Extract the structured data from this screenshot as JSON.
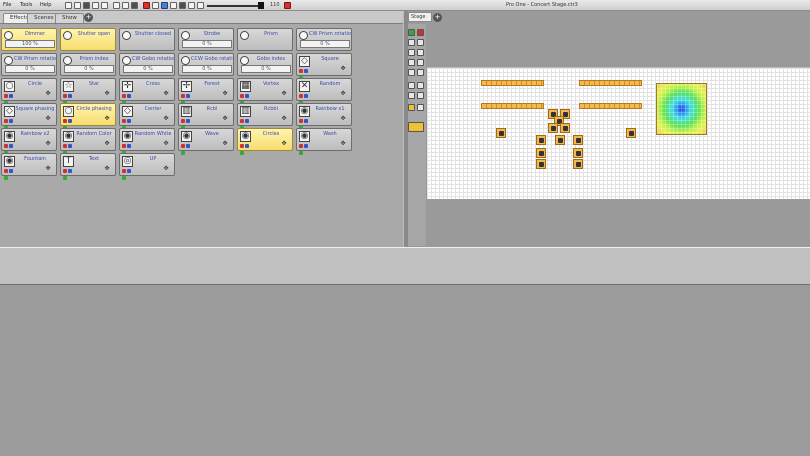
{
  "menubar": {
    "file": "File",
    "tools": "Tools",
    "help": "Help"
  },
  "volume": {
    "value_text": "110",
    "level": 0.95
  },
  "window_title": "Pro One - Concert Stage.ctr3",
  "left_tabs": [
    {
      "label": "Effects",
      "active": true
    },
    {
      "label": "Scenes",
      "active": false
    },
    {
      "label": "Show",
      "active": false
    }
  ],
  "right_tab": {
    "label": "Stage"
  },
  "buttons": [
    {
      "label": "Dimmer",
      "value": "100 %",
      "kind": "slider",
      "hl": true
    },
    {
      "label": "Shutter open",
      "kind": "plain",
      "hl": true
    },
    {
      "label": "Shutter closed",
      "kind": "plain",
      "hl": false
    },
    {
      "label": "Strobe",
      "value": "0 %",
      "kind": "slider",
      "hl": false
    },
    {
      "label": "Prism",
      "kind": "plain",
      "hl": false
    },
    {
      "label": "CW Prism rotation",
      "value": "0 %",
      "kind": "slider",
      "hl": false
    },
    {
      "label": "CW Prism rotatio",
      "value": "0 %",
      "kind": "slider",
      "hl": false
    },
    {
      "label": "Prism index",
      "value": "0 %",
      "kind": "slider",
      "hl": false
    },
    {
      "label": "CW Gobo rotation",
      "value": "0 %",
      "kind": "slider",
      "hl": false
    },
    {
      "label": "CCW Gobo rotatio",
      "value": "0 %",
      "kind": "slider",
      "hl": false
    },
    {
      "label": "Gobo index",
      "value": "0 %",
      "kind": "slider",
      "hl": false
    },
    {
      "label": "Square",
      "kind": "effect",
      "icon": "diamond",
      "hl": false
    },
    {
      "label": "Circle",
      "kind": "effect",
      "icon": "circle",
      "hl": false
    },
    {
      "label": "Star",
      "kind": "effect",
      "icon": "star",
      "hl": false
    },
    {
      "label": "Cross",
      "kind": "effect",
      "icon": "cross",
      "hl": false
    },
    {
      "label": "Forest",
      "kind": "effect",
      "icon": "arrows",
      "hl": false
    },
    {
      "label": "Vortex",
      "kind": "effect",
      "icon": "grid",
      "hl": false
    },
    {
      "label": "Random",
      "kind": "effect",
      "icon": "x",
      "hl": false
    },
    {
      "label": "Square phasing",
      "kind": "effect",
      "icon": "diamond",
      "hl": false
    },
    {
      "label": "Circle phasing",
      "kind": "effect",
      "icon": "circle",
      "hl": true
    },
    {
      "label": "Center",
      "kind": "effect",
      "icon": "diamond",
      "hl": false
    },
    {
      "label": "Rcbi",
      "kind": "effect",
      "icon": "rainbow",
      "hl": false
    },
    {
      "label": "Rcbbi",
      "kind": "effect",
      "icon": "rainbow",
      "hl": false
    },
    {
      "label": "Rainbow x1",
      "kind": "effect",
      "icon": "wheel",
      "hl": false
    },
    {
      "label": "Rainbow x2",
      "kind": "effect",
      "icon": "wheel",
      "hl": false
    },
    {
      "label": "Random Color",
      "kind": "effect",
      "icon": "wheel",
      "hl": false
    },
    {
      "label": "Random White",
      "kind": "effect",
      "icon": "wheel",
      "hl": false
    },
    {
      "label": "Wave",
      "kind": "effect",
      "icon": "wheel",
      "hl": false
    },
    {
      "label": "Circles",
      "kind": "effect",
      "icon": "wheel",
      "hl": true
    },
    {
      "label": "Wash",
      "kind": "effect",
      "icon": "wheel",
      "hl": false
    },
    {
      "label": "Fountain",
      "kind": "effect",
      "icon": "wheel",
      "hl": false
    },
    {
      "label": "Text",
      "kind": "effect",
      "icon": "text",
      "hl": false
    },
    {
      "label": "UP",
      "kind": "effect",
      "icon": "ring",
      "hl": false
    }
  ],
  "colors": {
    "highlight": "#f7dd6e",
    "label_blue": "#3a4aa8",
    "fixture_orange": "#f2b94e"
  }
}
